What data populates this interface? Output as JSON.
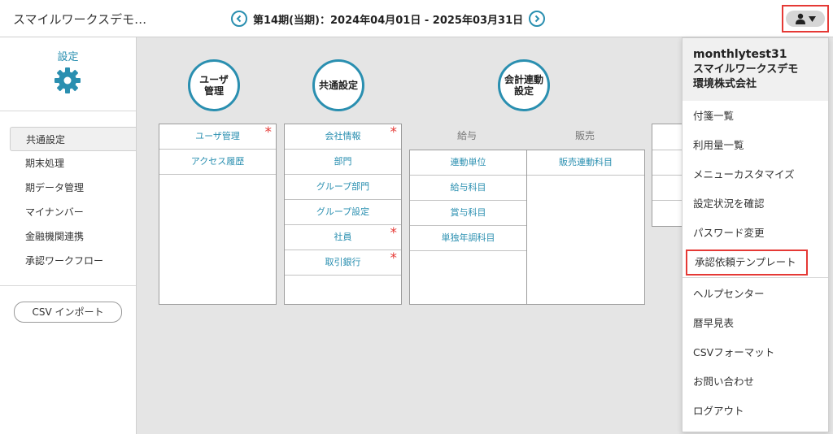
{
  "header": {
    "app_title": "スマイルワークスデモ…",
    "period": "第14期(当期)：2024年04月01日 - 2025年03月31日"
  },
  "sidebar": {
    "title": "設定",
    "items": [
      {
        "label": "共通設定",
        "active": true
      },
      {
        "label": "期末処理"
      },
      {
        "label": "期データ管理"
      },
      {
        "label": "マイナンバー"
      },
      {
        "label": "金融機関連携"
      },
      {
        "label": "承認ワークフロー"
      }
    ],
    "csv_import": "CSV インポート"
  },
  "categories": {
    "user": {
      "title": "ユーザ\n管理",
      "items": [
        {
          "label": "ユーザ管理",
          "required": true
        },
        {
          "label": "アクセス履歴"
        }
      ]
    },
    "common": {
      "title": "共通設定",
      "items": [
        {
          "label": "会社情報",
          "required": true
        },
        {
          "label": "部門"
        },
        {
          "label": "グループ部門"
        },
        {
          "label": "グループ設定"
        },
        {
          "label": "社員",
          "required": true
        },
        {
          "label": "取引銀行",
          "required": true
        }
      ]
    },
    "accounting": {
      "title": "会計連動\n設定",
      "columns": [
        {
          "label": "給与",
          "items": [
            "連動単位",
            "給与科目",
            "賞与科目",
            "単独年調科目"
          ]
        },
        {
          "label": "販売",
          "items": [
            "販売連動科目"
          ]
        }
      ]
    }
  },
  "dropdown": {
    "username": "monthlytest31",
    "org_line1": "スマイルワークスデモ",
    "org_line2": "環境株式会社",
    "items": [
      "付箋一覧",
      "利用量一覧",
      "メニューカスタマイズ",
      "設定状況を確認",
      "パスワード変更",
      "承認依頼テンプレート",
      "ヘルプセンター",
      "暦早見表",
      "CSVフォーマット",
      "お問い合わせ",
      "ログアウト"
    ]
  },
  "colors": {
    "accent": "#2a8fb0",
    "required": "#e53935",
    "highlight": "#e53935"
  }
}
